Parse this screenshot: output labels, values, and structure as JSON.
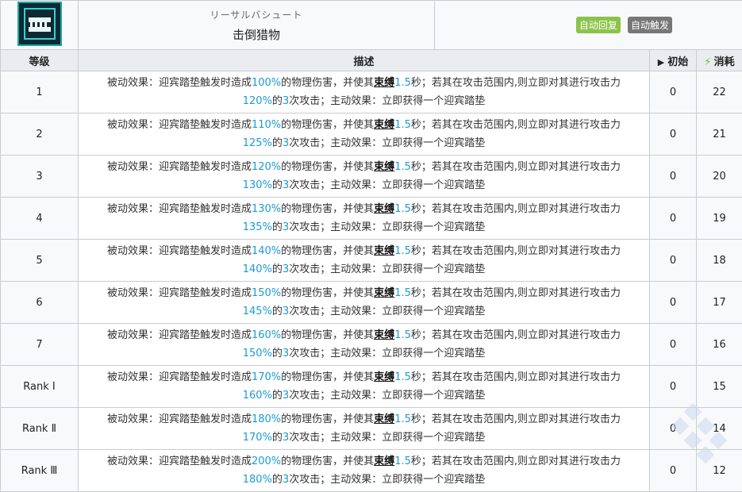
{
  "skill": {
    "jp_name": "リーサルバシュート",
    "name": "击倒猎物",
    "icon": "skill-trap-icon",
    "tags": [
      {
        "label": "自动回复",
        "color": "#8bc34a"
      },
      {
        "label": "自动触发",
        "color": "#777777"
      }
    ]
  },
  "columns": {
    "level": "等级",
    "desc": "描述",
    "initial": "初始",
    "cost": "消耗"
  },
  "text": {
    "p1": "被动效果：迎宾踏垫触发时造成",
    "p2": "的物理伤害，并使其",
    "kw": "束缚",
    "dur": "1.5",
    "p3": "秒；若其在攻击范围内,则立即对其进行攻击力",
    "p4": "的",
    "hits": "3",
    "p5": "次攻击；主动效果：立即获得一个迎宾踏垫"
  },
  "rows": [
    {
      "level": "1",
      "dmg": "100%",
      "atk": "120%",
      "initial": "0",
      "cost": "22"
    },
    {
      "level": "2",
      "dmg": "110%",
      "atk": "125%",
      "initial": "0",
      "cost": "21"
    },
    {
      "level": "3",
      "dmg": "120%",
      "atk": "130%",
      "initial": "0",
      "cost": "20"
    },
    {
      "level": "4",
      "dmg": "130%",
      "atk": "135%",
      "initial": "0",
      "cost": "19"
    },
    {
      "level": "5",
      "dmg": "140%",
      "atk": "140%",
      "initial": "0",
      "cost": "18"
    },
    {
      "level": "6",
      "dmg": "150%",
      "atk": "145%",
      "initial": "0",
      "cost": "17"
    },
    {
      "level": "7",
      "dmg": "160%",
      "atk": "150%",
      "initial": "0",
      "cost": "16"
    },
    {
      "level": "Rank Ⅰ",
      "dmg": "170%",
      "atk": "160%",
      "initial": "0",
      "cost": "15"
    },
    {
      "level": "Rank Ⅱ",
      "dmg": "180%",
      "atk": "170%",
      "initial": "0",
      "cost": "14"
    },
    {
      "level": "Rank Ⅲ",
      "dmg": "200%",
      "atk": "180%",
      "initial": "0",
      "cost": "12"
    }
  ]
}
